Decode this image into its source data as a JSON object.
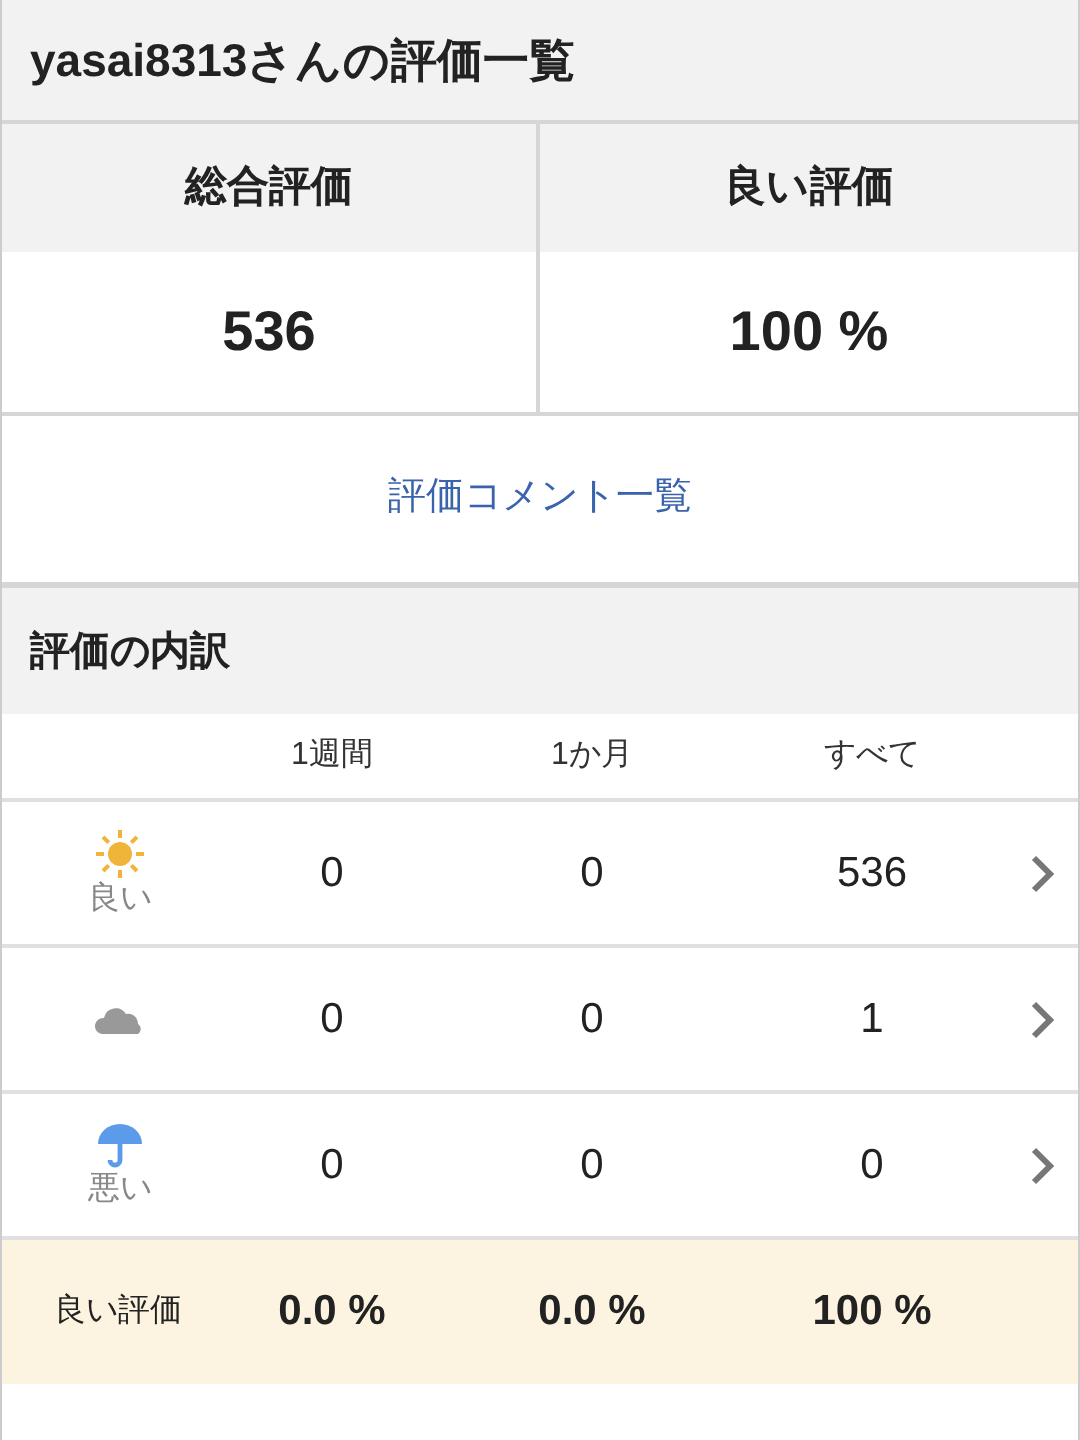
{
  "title": "yasai8313さんの評価一覧",
  "summary": [
    {
      "label": "総合評価",
      "value": "536"
    },
    {
      "label": "良い評価",
      "value": "100 %"
    }
  ],
  "comments_link": "評価コメント一覧",
  "breakdown": {
    "title": "評価の内訳",
    "columns": [
      "1週間",
      "1か月",
      "すべて"
    ],
    "rows": [
      {
        "kind": "sun",
        "label": "良い",
        "values": [
          "0",
          "0",
          "536"
        ]
      },
      {
        "kind": "cloud",
        "values": [
          "0",
          "0",
          "1"
        ]
      },
      {
        "kind": "umbrella",
        "label": "悪い",
        "values": [
          "0",
          "0",
          "0"
        ]
      }
    ],
    "rate_row": {
      "label": "良い評価",
      "values": [
        "0.0 %",
        "0.0 %",
        "100 %"
      ]
    }
  }
}
